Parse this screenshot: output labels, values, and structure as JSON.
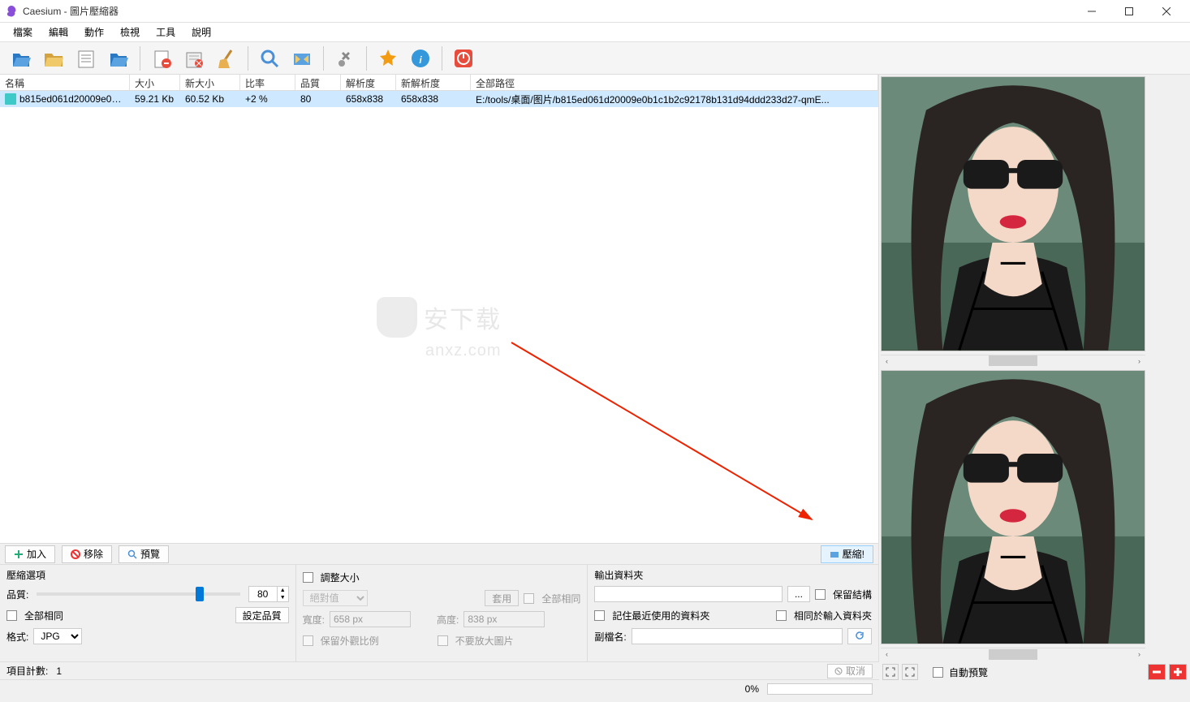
{
  "title": "Caesium - 圖片壓縮器",
  "menu": {
    "items": [
      "檔案",
      "編輯",
      "動作",
      "檢視",
      "工具",
      "說明"
    ]
  },
  "table": {
    "headers": [
      "名稱",
      "大小",
      "新大小",
      "比率",
      "品質",
      "解析度",
      "新解析度",
      "全部路徑"
    ],
    "row": {
      "name": "b815ed061d20009e0b...",
      "size": "59.21 Kb",
      "newsize": "60.52 Kb",
      "ratio": "+2 %",
      "quality": "80",
      "res": "658x838",
      "newres": "658x838",
      "path": "E:/tools/桌面/图片/b815ed061d20009e0b1c1b2c92178b131d94ddd233d27-qmE..."
    }
  },
  "actions": {
    "add": "加入",
    "remove": "移除",
    "preview": "預覽",
    "compress": "壓縮!"
  },
  "compress": {
    "title": "壓縮選項",
    "quality_label": "品質:",
    "quality_value": "80",
    "same_all": "全部相同",
    "set_quality": "設定品質",
    "format_label": "格式:",
    "format_value": "JPG"
  },
  "resize": {
    "title": "調整大小",
    "mode": "絕對值",
    "apply": "套用",
    "same_all": "全部相同",
    "width_label": "寬度:",
    "width_value": "658 px",
    "height_label": "高度:",
    "height_value": "838 px",
    "keep_ratio": "保留外觀比例",
    "no_enlarge": "不要放大圖片"
  },
  "output": {
    "title": "輸出資料夾",
    "browse": "...",
    "keep_structure": "保留結構",
    "remember": "記住最近使用的資料夾",
    "same_input": "相同於輸入資料夾",
    "suffix_label": "副檔名:",
    "suffix_value": ""
  },
  "status": {
    "count_label": "項目計數:",
    "count_value": "1",
    "progress_pct": "0%",
    "cancel": "取消"
  },
  "right": {
    "auto_preview": "自動預覽"
  },
  "watermark": {
    "text1": "安下载",
    "text2": "anxz.com"
  }
}
